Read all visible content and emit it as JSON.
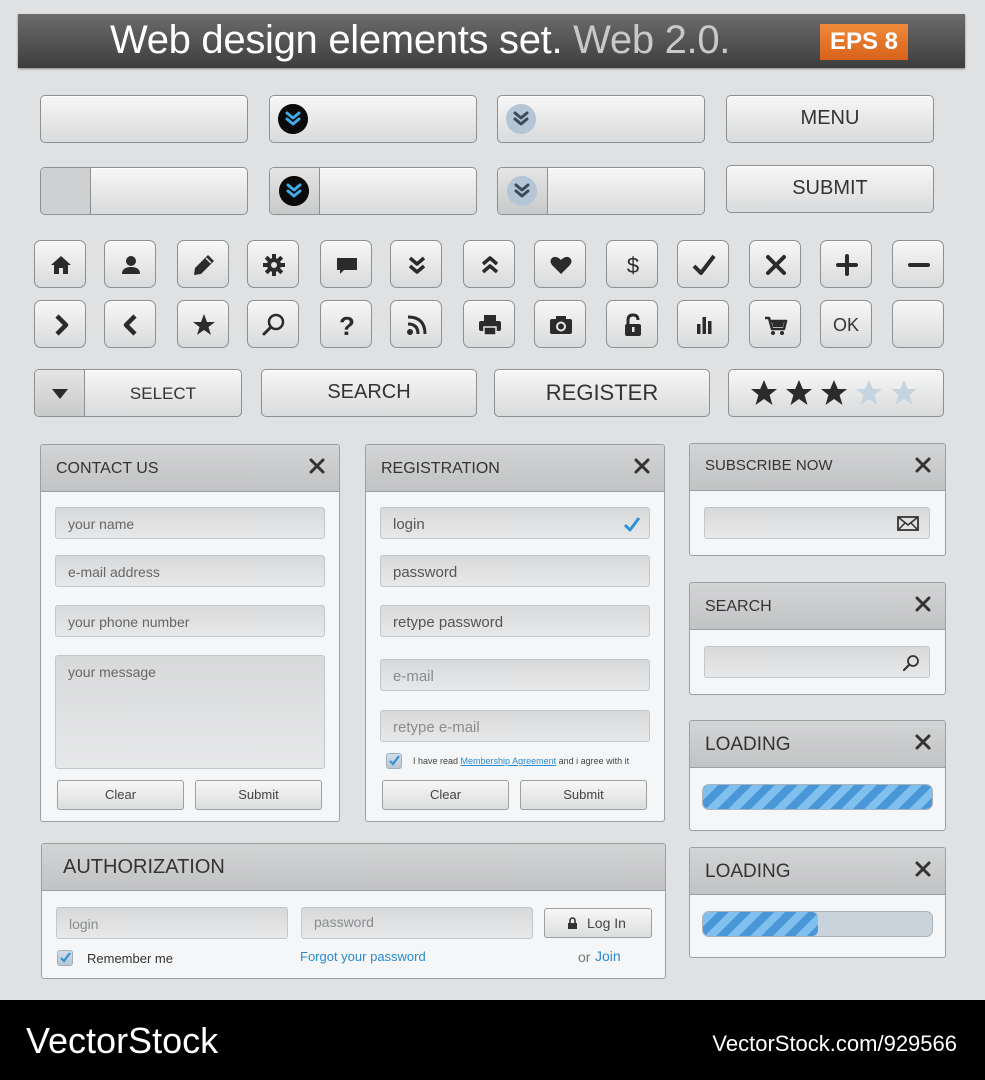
{
  "header": {
    "title": "Web design elements set.",
    "subtitle": "Web 2.0.",
    "badge": "EPS 8"
  },
  "buttons": {
    "menu": "MENU",
    "submit": "SUBMIT",
    "select": "SELECT",
    "search": "SEARCH",
    "register": "REGISTER",
    "ok": "OK"
  },
  "rating": {
    "filled": 3,
    "total": 5
  },
  "contact": {
    "title": "CONTACT US",
    "name_placeholder": "your name",
    "email_placeholder": "e-mail address",
    "phone_placeholder": "your phone number",
    "message_placeholder": "your message",
    "clear": "Clear",
    "submit": "Submit"
  },
  "registration": {
    "title": "REGISTRATION",
    "login": "login",
    "password": "password",
    "retype_password": "retype password",
    "email": "e-mail",
    "retype_email": "retype e-mail",
    "agree_prefix": "I have read",
    "agree_link": "Membership Agreement",
    "agree_suffix": "and i agree with it",
    "clear": "Clear",
    "submit": "Submit"
  },
  "subscribe": {
    "title": "SUBSCRIBE NOW"
  },
  "search_panel": {
    "title": "SEARCH"
  },
  "loading1": {
    "title": "LOADING",
    "progress": 1.0
  },
  "loading2": {
    "title": "LOADING",
    "progress": 0.5
  },
  "authorization": {
    "title": "AUTHORIZATION",
    "login": "login",
    "password": "password",
    "login_button": "Log In",
    "remember": "Remember me",
    "forgot": "Forgot your password",
    "or": "or",
    "join": "Join"
  },
  "footer": {
    "brand": "VectorStock",
    "image_id": "VectorStock.com/929566"
  },
  "colors": {
    "accent": "#2a8bd1",
    "badge": "#e0702a",
    "header_bg": "#4a4a4a"
  }
}
